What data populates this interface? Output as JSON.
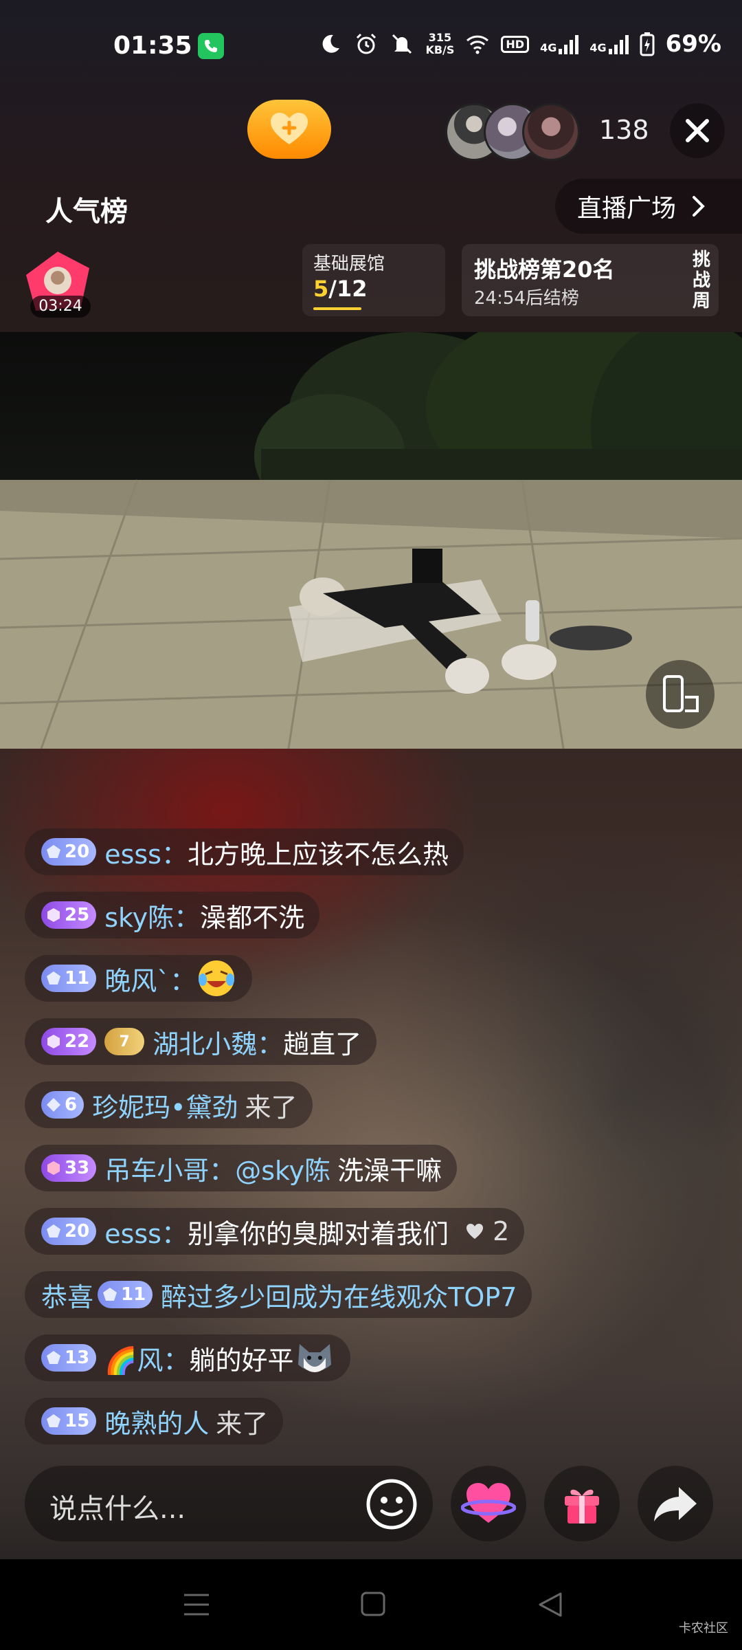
{
  "status_bar": {
    "time": "01:35",
    "net_speed_value": "315",
    "net_speed_unit": "KB/S",
    "hd": "HD",
    "signal1": "4G",
    "signal2": "4G",
    "battery": "69%"
  },
  "top": {
    "viewer_count": "138",
    "hot_rank": "人气榜",
    "plaza": "直播广场"
  },
  "host": {
    "live_duration": "03:24"
  },
  "hall": {
    "title": "基础展馆",
    "current": "5",
    "total": "/12"
  },
  "challenge": {
    "title": "挑战榜第20名",
    "subtitle": "24:54后结榜",
    "week": "挑战周"
  },
  "chat": [
    {
      "level": "20",
      "user": "esss：",
      "text": "北方晚上应该不怎么热"
    },
    {
      "level": "25",
      "user": "sky陈：",
      "text": "澡都不洗"
    },
    {
      "level": "11",
      "user": "晚风`：",
      "text": ""
    },
    {
      "level": "22",
      "fan_level": "7",
      "user": "湖北小魏：",
      "text": "趟直了"
    },
    {
      "level": "6",
      "user": "珍妮玛•黛劲",
      "text": "来了"
    },
    {
      "level": "33",
      "user": "吊车小哥：@sky陈",
      "text": "洗澡干嘛"
    },
    {
      "level": "20",
      "user": "esss：",
      "text": "别拿你的臭脚对着我们",
      "likes": "2"
    },
    {
      "prefix": "恭喜",
      "level": "11",
      "user": "醉过多少回成为在线观众TOP7"
    },
    {
      "level": "13",
      "user": "🌈风：",
      "text": "躺的好平"
    },
    {
      "level": "15",
      "user": "晚熟的人",
      "text": "来了"
    }
  ],
  "input": {
    "placeholder": "说点什么..."
  },
  "watermark": "卡农社区",
  "colors": {
    "username": "#8fd3ff",
    "accent_gold": "#ffd232",
    "call_green": "#22c55e"
  }
}
